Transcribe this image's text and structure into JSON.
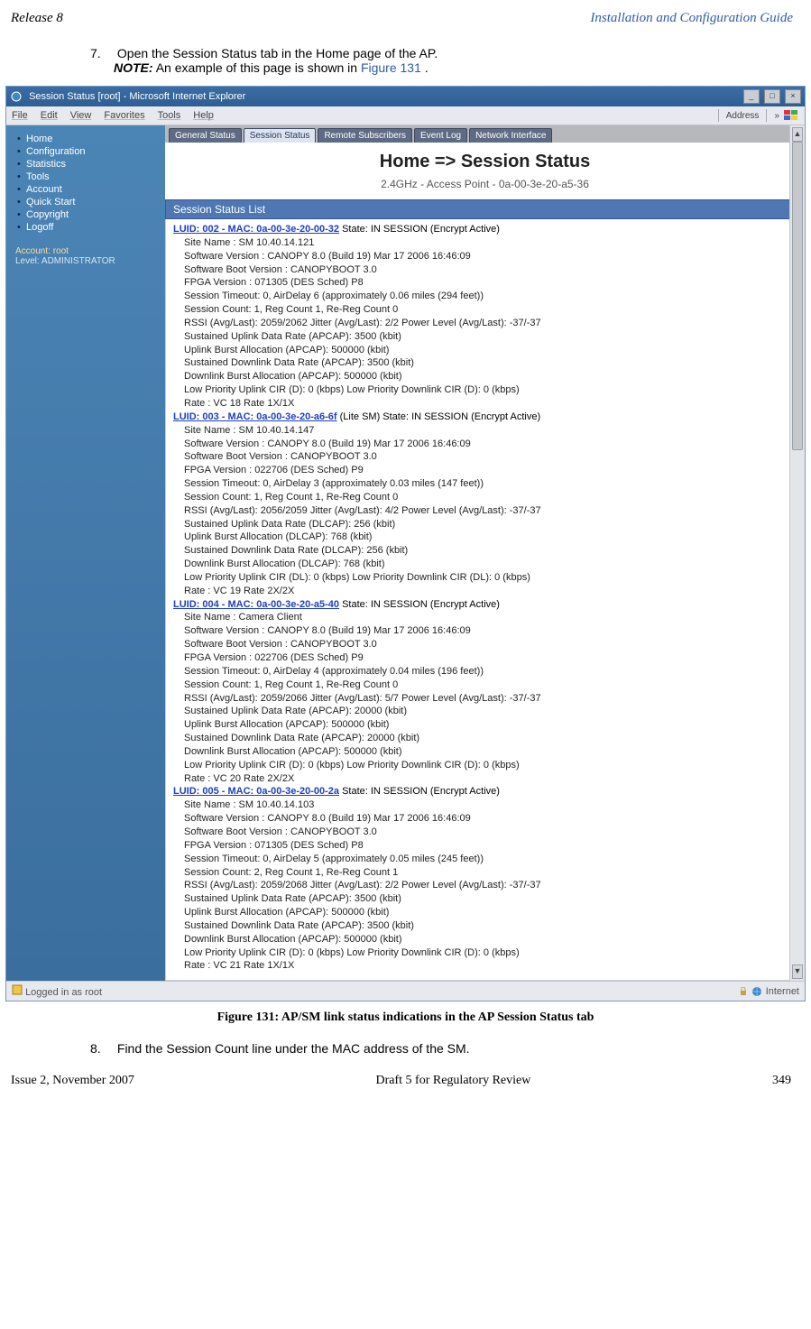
{
  "pageHeader": {
    "left": "Release 8",
    "right": "Installation and Configuration Guide"
  },
  "step7": {
    "num": "7.",
    "text": "Open the Session Status tab in the Home page of the AP.",
    "notePrefix": "NOTE:",
    "noteText": " An example of this page is shown in ",
    "noteLink": "Figure 131",
    "noteSuffix": "."
  },
  "ie": {
    "title": "Session Status [root] - Microsoft Internet Explorer",
    "menus": [
      "File",
      "Edit",
      "View",
      "Favorites",
      "Tools",
      "Help"
    ],
    "addressLabel": "Address",
    "arrows": "»",
    "sidebar": {
      "items": [
        "Home",
        "Configuration",
        "Statistics",
        "Tools",
        "Account",
        "Quick Start",
        "Copyright",
        "Logoff"
      ],
      "acct": "Account: root",
      "level": "Level: ADMINISTRATOR"
    },
    "tabs": [
      "General Status",
      "Session Status",
      "Remote Subscribers",
      "Event Log",
      "Network Interface"
    ],
    "activeTab": 1,
    "pageTitle": "Home => Session Status",
    "subtitle": "2.4GHz - Access Point - 0a-00-3e-20-a5-36",
    "listHeader": "Session Status List",
    "entries": [
      {
        "luid": "LUID: 002",
        "mac": "MAC: 0a-00-3e-20-00-32",
        "state": "State: IN SESSION (Encrypt Active)",
        "rows": [
          "Site Name : SM 10.40.14.121",
          "Software Version : CANOPY 8.0 (Build 19) Mar 17 2006 16:46:09",
          "Software Boot Version : CANOPYBOOT 3.0",
          "FPGA Version : 071305 (DES Sched) P8",
          "Session Timeout: 0, AirDelay 6 (approximately 0.06 miles (294 feet))",
          "Session Count: 1, Reg Count 1, Re-Reg Count 0",
          "RSSI (Avg/Last): 2059/2062    Jitter (Avg/Last): 2/2    Power Level (Avg/Last): -37/-37",
          "Sustained Uplink Data Rate (APCAP): 3500 (kbit)",
          "Uplink Burst Allocation (APCAP): 500000 (kbit)",
          "Sustained Downlink Data Rate (APCAP): 3500 (kbit)",
          "Downlink Burst Allocation (APCAP): 500000 (kbit)",
          "Low Priority Uplink CIR (D): 0 (kbps) Low Priority Downlink CIR (D): 0 (kbps)",
          "Rate : VC 18 Rate 1X/1X"
        ]
      },
      {
        "luid": "LUID: 003",
        "mac": "MAC: 0a-00-3e-20-a6-6f",
        "state": "(Lite SM) State: IN SESSION (Encrypt Active)",
        "rows": [
          "Site Name : SM 10.40.14.147",
          "Software Version : CANOPY 8.0 (Build 19) Mar 17 2006 16:46:09",
          "Software Boot Version : CANOPYBOOT 3.0",
          "FPGA Version : 022706 (DES Sched) P9",
          "Session Timeout: 0, AirDelay 3 (approximately 0.03 miles (147 feet))",
          "Session Count: 1, Reg Count 1, Re-Reg Count 0",
          "RSSI (Avg/Last): 2056/2059    Jitter (Avg/Last): 4/2    Power Level (Avg/Last): -37/-37",
          "Sustained Uplink Data Rate (DLCAP): 256 (kbit)",
          "Uplink Burst Allocation (DLCAP): 768 (kbit)",
          "Sustained Downlink Data Rate (DLCAP): 256 (kbit)",
          "Downlink Burst Allocation (DLCAP): 768 (kbit)",
          "Low Priority Uplink CIR (DL): 0 (kbps) Low Priority Downlink CIR (DL): 0 (kbps)",
          "Rate : VC 19 Rate 2X/2X"
        ]
      },
      {
        "luid": "LUID: 004",
        "mac": "MAC: 0a-00-3e-20-a5-40",
        "state": "State: IN SESSION (Encrypt Active)",
        "rows": [
          "Site Name : Camera Client",
          "Software Version : CANOPY 8.0 (Build 19) Mar 17 2006 16:46:09",
          "Software Boot Version : CANOPYBOOT 3.0",
          "FPGA Version : 022706 (DES Sched) P9",
          "Session Timeout: 0, AirDelay 4 (approximately 0.04 miles (196 feet))",
          "Session Count: 1, Reg Count 1, Re-Reg Count 0",
          "RSSI (Avg/Last): 2059/2066    Jitter (Avg/Last): 5/7    Power Level (Avg/Last): -37/-37",
          "Sustained Uplink Data Rate (APCAP): 20000 (kbit)",
          "Uplink Burst Allocation (APCAP): 500000 (kbit)",
          "Sustained Downlink Data Rate (APCAP): 20000 (kbit)",
          "Downlink Burst Allocation (APCAP): 500000 (kbit)",
          "Low Priority Uplink CIR (D): 0 (kbps) Low Priority Downlink CIR (D): 0 (kbps)",
          "Rate : VC 20 Rate 2X/2X"
        ]
      },
      {
        "luid": "LUID: 005",
        "mac": "MAC: 0a-00-3e-20-00-2a",
        "state": "State: IN SESSION (Encrypt Active)",
        "rows": [
          "Site Name : SM 10.40.14.103",
          "Software Version : CANOPY 8.0 (Build 19) Mar 17 2006 16:46:09",
          "Software Boot Version : CANOPYBOOT 3.0",
          "FPGA Version : 071305 (DES Sched) P8",
          "Session Timeout: 0, AirDelay 5 (approximately 0.05 miles (245 feet))",
          "Session Count: 2, Reg Count 1, Re-Reg Count 1",
          "RSSI (Avg/Last): 2059/2068    Jitter (Avg/Last): 2/2    Power Level (Avg/Last): -37/-37",
          "Sustained Uplink Data Rate (APCAP): 3500 (kbit)",
          "Uplink Burst Allocation (APCAP): 500000 (kbit)",
          "Sustained Downlink Data Rate (APCAP): 3500 (kbit)",
          "Downlink Burst Allocation (APCAP): 500000 (kbit)",
          "Low Priority Uplink CIR (D): 0 (kbps) Low Priority Downlink CIR (D): 0 (kbps)",
          "Rate : VC 21 Rate 1X/1X"
        ]
      }
    ],
    "status": {
      "left": "Logged in as root",
      "right": "Internet"
    }
  },
  "caption": "Figure 131: AP/SM link status indications in the AP Session Status tab",
  "step8": {
    "num": "8.",
    "text": "Find the Session Count line under the MAC address of the SM."
  },
  "pageFooter": {
    "left": "Issue 2, November 2007",
    "mid": "Draft 5 for Regulatory Review",
    "right": "349"
  }
}
